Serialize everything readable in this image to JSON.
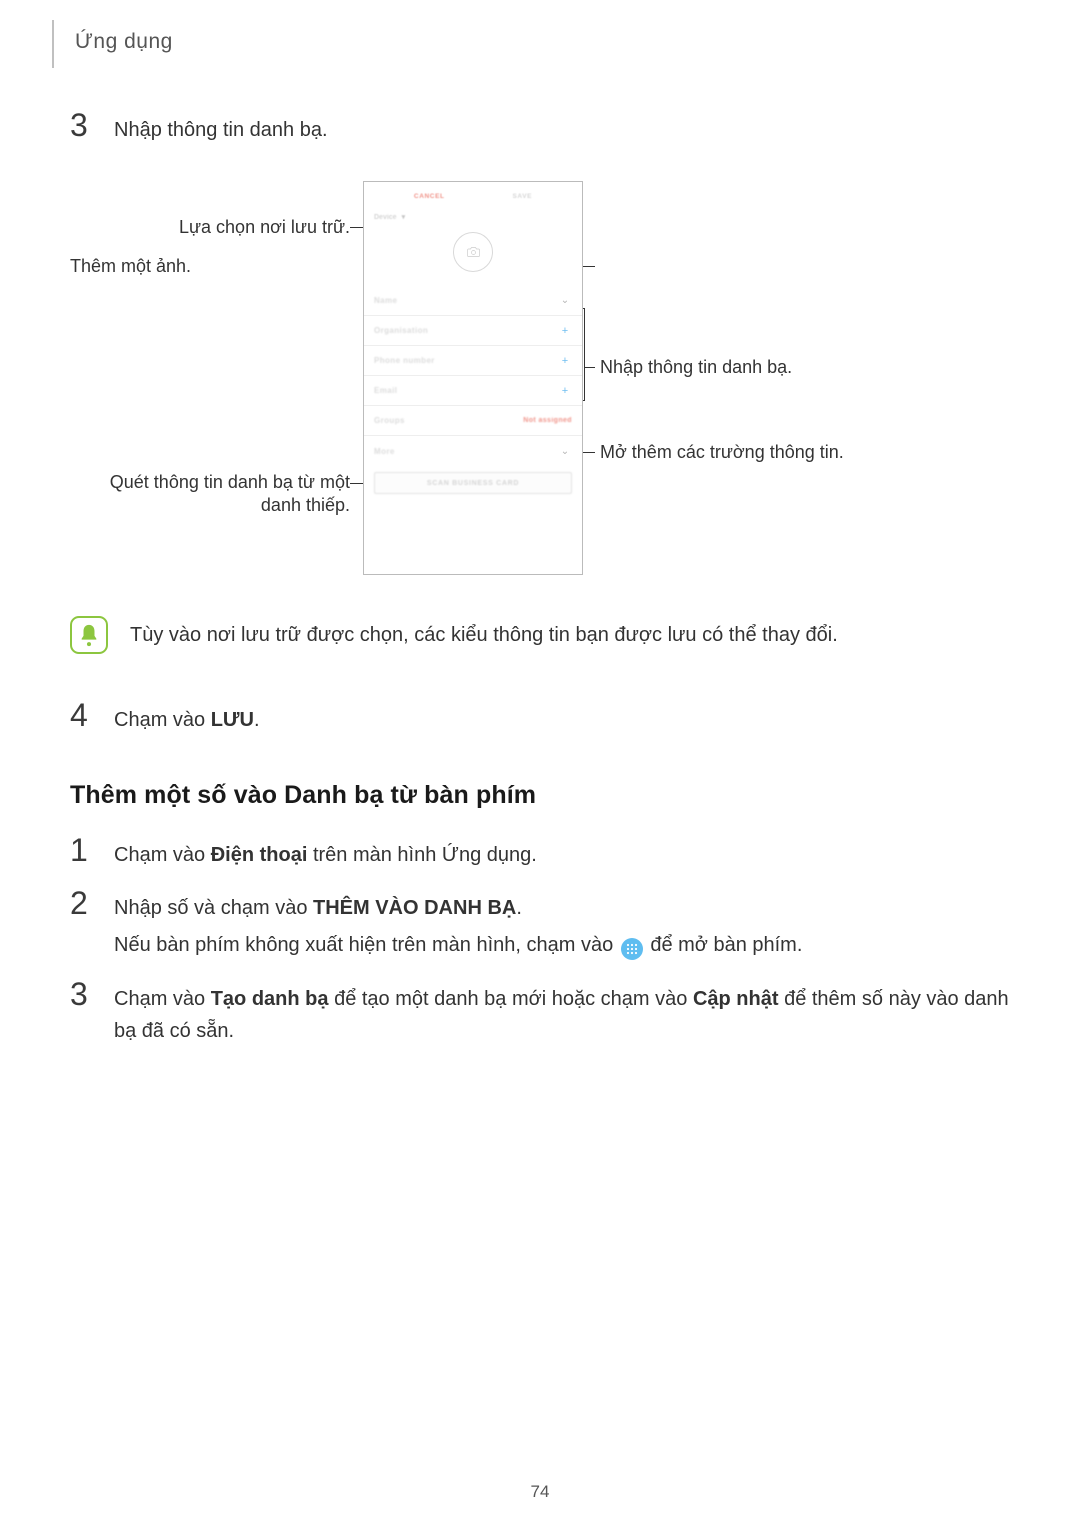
{
  "header": {
    "title": "Ứng dụng"
  },
  "step3_top": {
    "num": "3",
    "text": "Nhập thông tin danh bạ."
  },
  "diagram": {
    "left_labels": {
      "storage": "Lựa chọn nơi lưu trữ.",
      "scan_line1": "Quét thông tin danh bạ từ một",
      "scan_line2": "danh thiếp."
    },
    "right_labels": {
      "add_image": "Thêm một ảnh.",
      "enter_info": "Nhập thông tin danh bạ.",
      "more_fields": "Mở thêm các trường thông tin."
    },
    "phone": {
      "cancel": "CANCEL",
      "save": "SAVE",
      "device": "Device",
      "fields": {
        "name": "Name",
        "organisation": "Organisation",
        "phone": "Phone number",
        "email": "Email",
        "groups": "Groups",
        "groups_value": "Not assigned",
        "more": "More"
      },
      "scan": "SCAN BUSINESS CARD"
    }
  },
  "note": {
    "text": "Tùy vào nơi lưu trữ được chọn, các kiểu thông tin bạn được lưu có thể thay đổi."
  },
  "step4": {
    "num": "4",
    "pre": "Chạm vào ",
    "bold": "LƯU",
    "post": "."
  },
  "subheading": "Thêm một số vào Danh bạ từ bàn phím",
  "kb": {
    "step1": {
      "num": "1",
      "pre": "Chạm vào ",
      "bold": "Điện thoại",
      "post": " trên màn hình Ứng dụng."
    },
    "step2": {
      "num": "2",
      "pre": "Nhập số và chạm vào ",
      "bold": "THÊM VÀO DANH BẠ",
      "post": ".",
      "line2_pre": "Nếu bàn phím không xuất hiện trên màn hình, chạm vào ",
      "line2_post": " để mở bàn phím."
    },
    "step3": {
      "num": "3",
      "pre": "Chạm vào ",
      "bold1": "Tạo danh bạ",
      "mid": " để tạo một danh bạ mới hoặc chạm vào ",
      "bold2": "Cập nhật",
      "post": " để thêm số này vào danh bạ đã có sẵn."
    }
  },
  "footer": {
    "page": "74"
  }
}
